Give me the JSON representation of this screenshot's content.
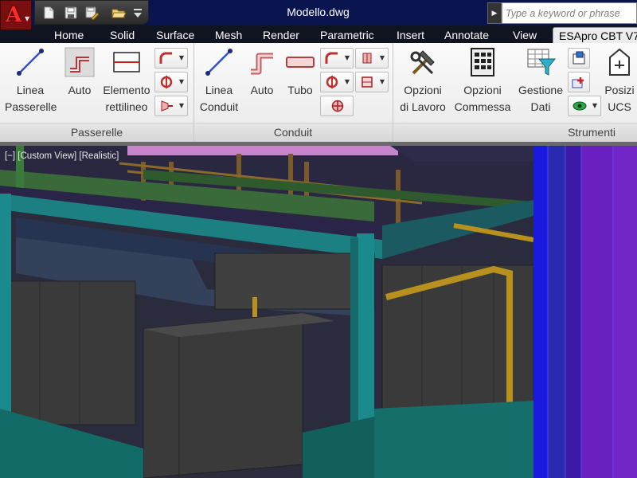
{
  "title_bar": {
    "document_title": "Modello.dwg",
    "search_placeholder": "Type a keyword or phrase",
    "app_button_letter": "A",
    "quick_access": [
      "new-icon",
      "save-icon",
      "save-as-icon",
      "open-icon",
      "customize-icon"
    ]
  },
  "tabs": [
    {
      "label": "Home"
    },
    {
      "label": "Solid"
    },
    {
      "label": "Surface"
    },
    {
      "label": "Mesh"
    },
    {
      "label": "Render"
    },
    {
      "label": "Parametric"
    },
    {
      "label": "Insert"
    },
    {
      "label": "Annotate"
    },
    {
      "label": "View"
    },
    {
      "label": "ESApro CBT V7"
    }
  ],
  "ribbon": {
    "panels": [
      {
        "label": "Passerelle"
      },
      {
        "label": "Conduit"
      },
      {
        "label": "Strumenti"
      }
    ],
    "passerelle": {
      "linea": {
        "line1": "Linea",
        "line2": "Passerelle"
      },
      "auto": {
        "line1": "Auto"
      },
      "elemento": {
        "line1": "Elemento",
        "line2": "rettilineo"
      }
    },
    "conduit": {
      "linea": {
        "line1": "Linea",
        "line2": "Conduit"
      },
      "auto": {
        "line1": "Auto"
      },
      "tubo": {
        "line1": "Tubo"
      }
    },
    "strumenti": {
      "opzioni_lavoro": {
        "line1": "Opzioni",
        "line2": "di Lavoro"
      },
      "opzioni_commessa": {
        "line1": "Opzioni",
        "line2": "Commessa"
      },
      "gestione_dati": {
        "line1": "Gestione",
        "line2": "Dati"
      },
      "posizione_ucs": {
        "line1": "Posizi",
        "line2": "UCS"
      }
    }
  },
  "viewport": {
    "label": "[−] [Custom View] [Realistic]"
  },
  "colors": {
    "title_bar": "#0a1550",
    "app_button": "#7a0f0f",
    "ribbon": "#efefef",
    "steel_teal": "#1a8a8c",
    "cable_tray_green": "#3f7a3a",
    "conduit_gold": "#b88a1e",
    "wall_blue": "#2020c8",
    "wall_purple": "#6a1fb0"
  }
}
